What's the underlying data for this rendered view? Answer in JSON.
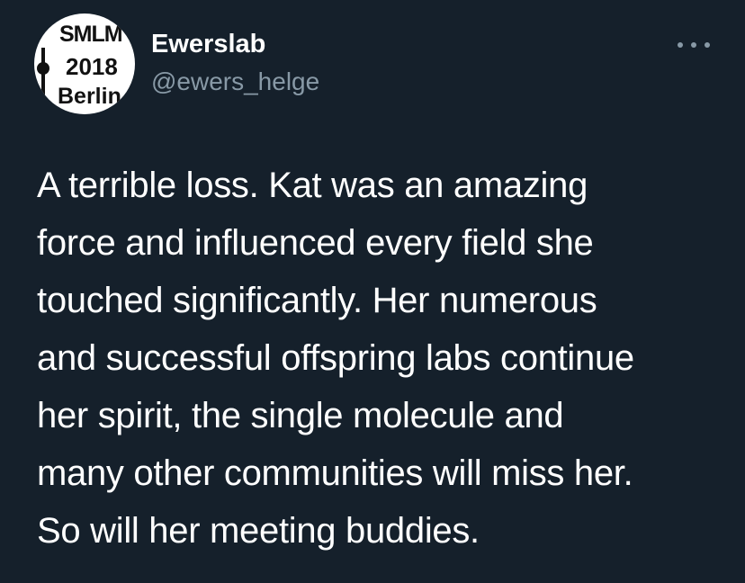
{
  "author": {
    "display_name": "Ewerslab",
    "handle": "@ewers_helge",
    "avatar": {
      "icon": "smlm-2018-berlin-logo",
      "line1": "SMLM",
      "line2": "2018",
      "line3": "Berlin"
    }
  },
  "menu": {
    "icon": "more-options-icon"
  },
  "tweet": {
    "lines": [
      "A terrible loss. Kat was an amazing",
      "force and influenced every field she",
      "touched significantly. Her numerous",
      "and successful offspring labs continue",
      "her spirit, the single molecule and",
      "many other communities will miss her.",
      "So will her meeting buddies."
    ]
  },
  "colors": {
    "background": "#15202b",
    "primary_text": "#ffffff",
    "secondary_text": "#8899a6"
  }
}
